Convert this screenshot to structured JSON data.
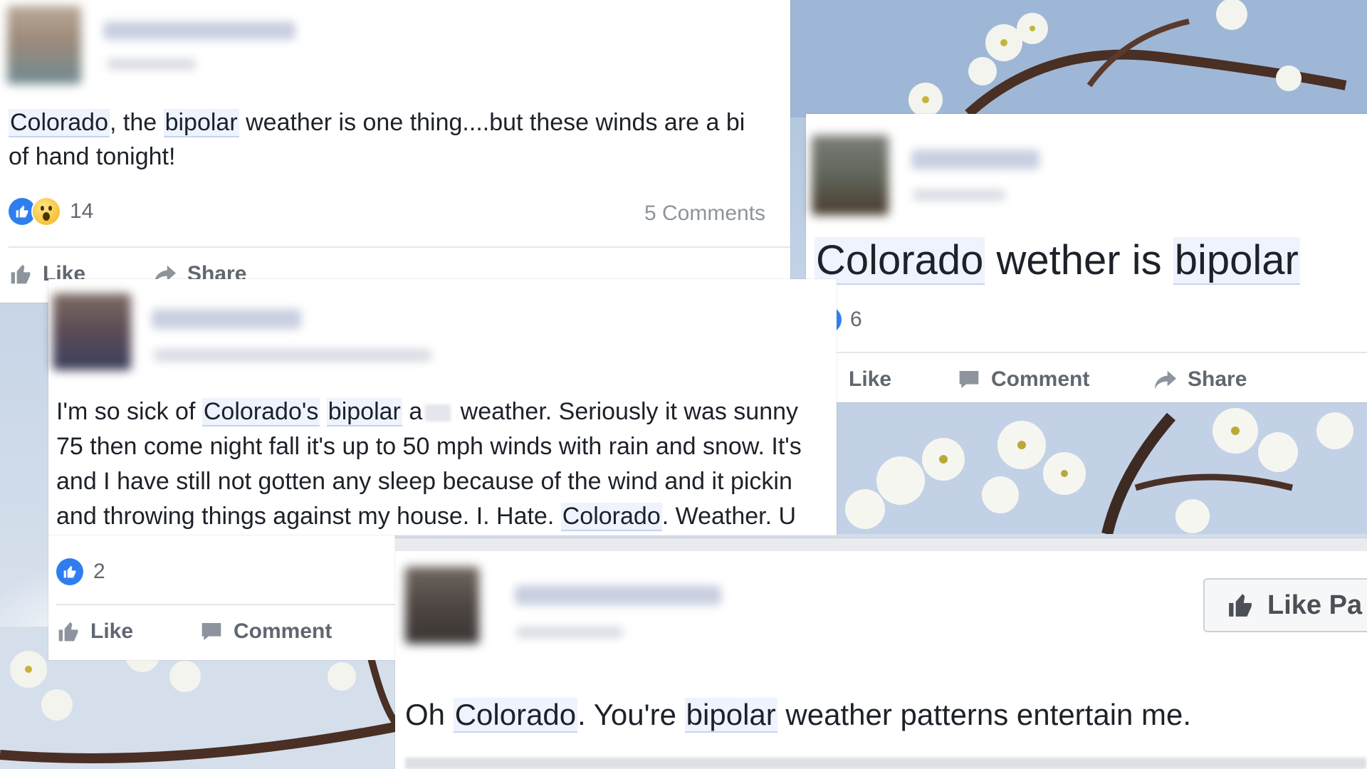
{
  "colors": {
    "like_blue": "#2f7ef0",
    "highlight_bg": "#eef3fd",
    "text": "#1d2129",
    "muted": "#606770"
  },
  "post1": {
    "text_line1": [
      "Colorado",
      ", the ",
      "bipolar",
      " weather is one thing....but these winds are a bi"
    ],
    "text_line2": "of hand tonight!",
    "reaction_count": "14",
    "comments_label": "5 Comments",
    "actions": {
      "like": "Like",
      "share": "Share"
    }
  },
  "post2": {
    "text": [
      "Colorado",
      " wether is ",
      "bipolar"
    ],
    "reaction_count": "6",
    "actions": {
      "like": "Like",
      "comment": "Comment",
      "share": "Share"
    }
  },
  "post3": {
    "line1": [
      "I'm so sick of ",
      "Colorado's",
      " ",
      "bipolar",
      " a",
      " weather. Seriously it was sunny"
    ],
    "line2": "75 then come night fall it's up to 50 mph winds with rain and snow. It's",
    "line3": "and I have still not gotten any sleep because of the wind and it pickin",
    "line4": [
      "and throwing things against my house. I. Hate. ",
      "Colorado",
      ". Weather. U"
    ],
    "reaction_count": "2",
    "actions": {
      "like": "Like",
      "comment": "Comment"
    }
  },
  "post4": {
    "text": [
      "Oh ",
      "Colorado",
      ". You're ",
      "bipolar",
      " weather patterns entertain me."
    ],
    "like_page_label": "Like Pa"
  },
  "icons": [
    "thumbs-up-icon",
    "wow-face-icon",
    "share-arrow-icon",
    "comment-bubble-icon"
  ]
}
